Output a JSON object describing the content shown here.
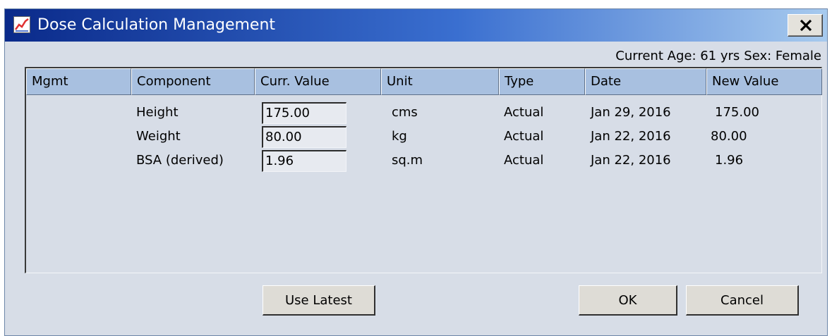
{
  "window": {
    "title": "Dose Calculation Management",
    "close_label": "X"
  },
  "patient": {
    "age_text": "Current Age: 61 yrs",
    "sex_text": "Sex: Female"
  },
  "table": {
    "columns": [
      "Mgmt",
      "Component",
      "Curr. Value",
      "Unit",
      "Type",
      "Date",
      "New Value"
    ],
    "rows": [
      {
        "mgmt": "",
        "component": "Height",
        "curr_value": "175.00",
        "unit": "cms",
        "type": "Actual",
        "date": "Jan 29, 2016",
        "new_value": "175.00"
      },
      {
        "mgmt": "",
        "component": "Weight",
        "curr_value": "80.00",
        "unit": "kg",
        "type": "Actual",
        "date": "Jan 22, 2016",
        "new_value": "80.00"
      },
      {
        "mgmt": "",
        "component": "BSA (derived)",
        "curr_value": "1.96",
        "unit": "sq.m",
        "type": "Actual",
        "date": "Jan 22, 2016",
        "new_value": "1.96"
      }
    ]
  },
  "buttons": {
    "use_latest": "Use Latest",
    "ok": "OK",
    "cancel": "Cancel"
  },
  "colors": {
    "titlebar_start": "#0a2a8a",
    "titlebar_end": "#a7caee",
    "header_bg": "#a8c0e0",
    "window_bg": "#d7dde7",
    "icon_red": "#e03030"
  }
}
